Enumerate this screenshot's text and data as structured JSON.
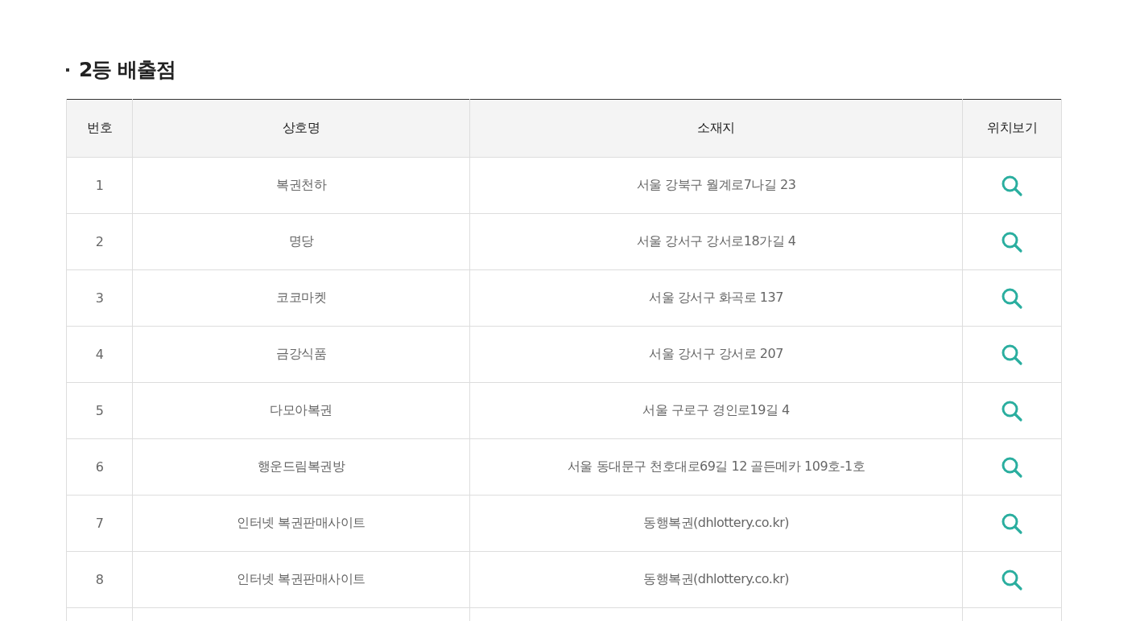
{
  "section_title": "2등 배출점",
  "table": {
    "columns": [
      "번호",
      "상호명",
      "소재지",
      "위치보기"
    ],
    "rows": [
      {
        "number": "1",
        "name": "복권천하",
        "address": "서울 강북구 월계로7나길 23"
      },
      {
        "number": "2",
        "name": "명당",
        "address": "서울 강서구 강서로18가길 4"
      },
      {
        "number": "3",
        "name": "코코마켓",
        "address": "서울 강서구 화곡로 137"
      },
      {
        "number": "4",
        "name": "금강식품",
        "address": "서울 강서구 강서로 207"
      },
      {
        "number": "5",
        "name": "다모아복권",
        "address": "서울 구로구 경인로19길 4"
      },
      {
        "number": "6",
        "name": "행운드림복권방",
        "address": "서울 동대문구 천호대로69길 12 골든메카 109호-1호"
      },
      {
        "number": "7",
        "name": "인터넷 복권판매사이트",
        "address": "동행복권(dhlottery.co.kr)"
      },
      {
        "number": "8",
        "name": "인터넷 복권판매사이트",
        "address": "동행복권(dhlottery.co.kr)"
      }
    ]
  }
}
